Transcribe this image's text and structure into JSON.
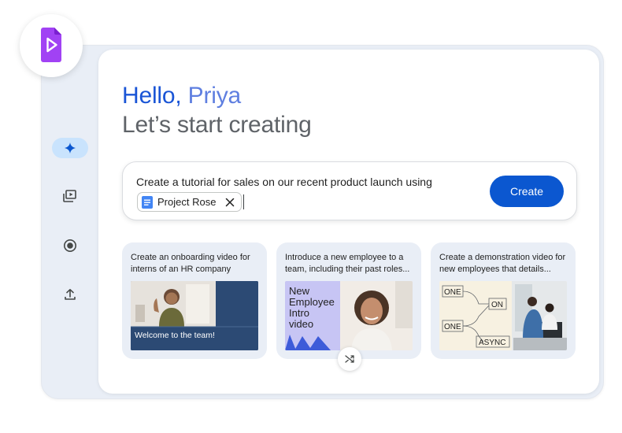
{
  "greeting": {
    "hello": "Hello,",
    "name": "Priya",
    "subtitle": "Let’s start creating"
  },
  "prompt": {
    "text": "Create a tutorial for sales on our recent product launch using",
    "chip_label": "Project Rose",
    "create_label": "Create"
  },
  "rail": {
    "items": [
      {
        "icon": "sparkle-icon",
        "active": true
      },
      {
        "icon": "video-library-icon",
        "active": false
      },
      {
        "icon": "record-icon",
        "active": false
      },
      {
        "icon": "upload-icon",
        "active": false
      }
    ]
  },
  "templates": [
    {
      "text": "Create an onboarding video for interns of an HR company",
      "thumb_caption": "Welcome to the team!"
    },
    {
      "text": "Introduce a new employee to a team, including their past roles...",
      "thumb_caption": "New Employee Intro video"
    },
    {
      "text": "Create a demonstration video for new employees that details...",
      "diagram_labels": [
        "ONE",
        "ON",
        "ONE",
        "ASYNC"
      ]
    }
  ],
  "colors": {
    "accent": "#0b57d0",
    "rail_active": "#c9e3fd",
    "app_icon": "#a142f4",
    "frame": "#e9eef6"
  }
}
